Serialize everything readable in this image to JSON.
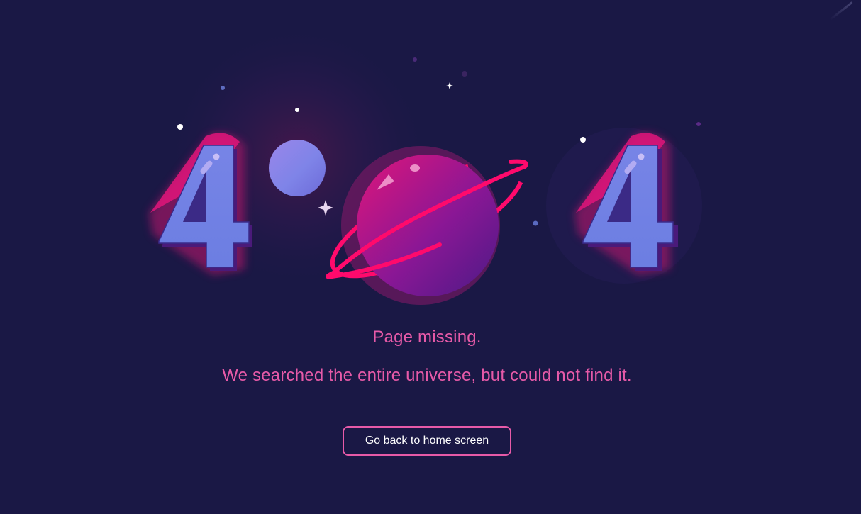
{
  "illustration": {
    "digit_left": "4",
    "digit_right": "4"
  },
  "message": {
    "line1": "Page missing.",
    "line2": "We searched the entire universe, but could not find it."
  },
  "actions": {
    "home_label": "Go back to home screen"
  },
  "colors": {
    "background": "#1a1845",
    "accent_pink": "#e75aa8",
    "digit_fill": "#6e7fe0",
    "planet_pink": "#d4147a",
    "planet_purple": "#6a1b9a",
    "ring": "#ff0a6c",
    "moon": "#8a7fe6"
  }
}
